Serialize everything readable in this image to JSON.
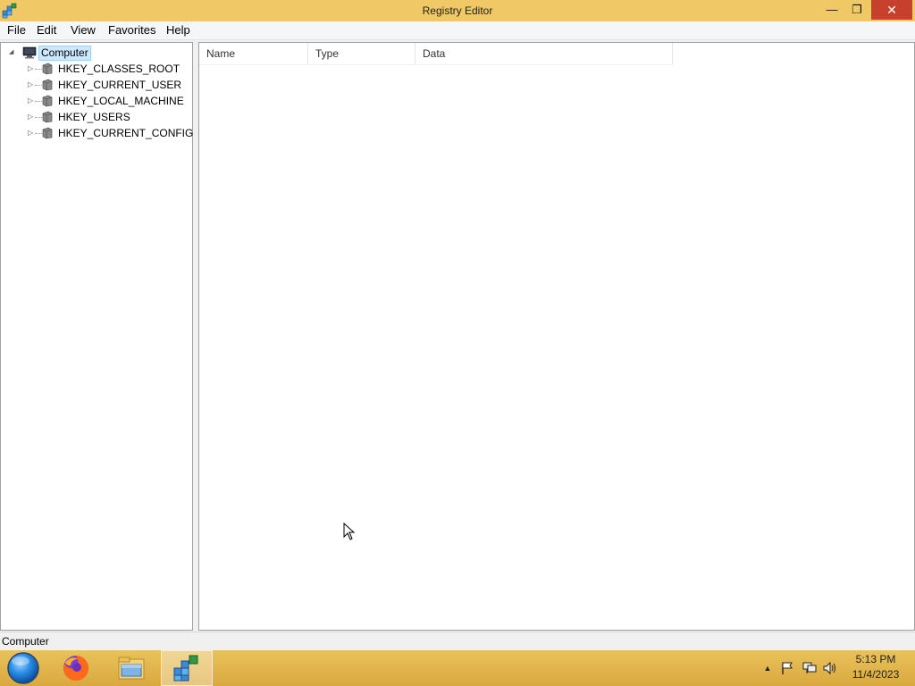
{
  "window": {
    "title": "Registry Editor",
    "minimize_glyph": "—",
    "maximize_glyph": "❐",
    "close_glyph": "✕"
  },
  "menu": {
    "items": [
      "File",
      "Edit",
      "View",
      "Favorites",
      "Help"
    ]
  },
  "tree": {
    "root": {
      "label": "Computer",
      "expander": "◢",
      "icon": "computer-icon",
      "selected": true
    },
    "keys": [
      {
        "label": "HKEY_CLASSES_ROOT",
        "expander": "▷",
        "icon": "registry-hive-icon"
      },
      {
        "label": "HKEY_CURRENT_USER",
        "expander": "▷",
        "icon": "registry-hive-icon"
      },
      {
        "label": "HKEY_LOCAL_MACHINE",
        "expander": "▷",
        "icon": "registry-hive-icon"
      },
      {
        "label": "HKEY_USERS",
        "expander": "▷",
        "icon": "registry-hive-icon"
      },
      {
        "label": "HKEY_CURRENT_CONFIG",
        "expander": "▷",
        "icon": "registry-hive-icon"
      }
    ]
  },
  "list": {
    "columns": [
      "Name",
      "Type",
      "Data"
    ]
  },
  "statusbar": {
    "text": "Computer"
  },
  "taskbar": {
    "items": [
      {
        "name": "start-button",
        "icon": "start-orb-icon"
      },
      {
        "name": "firefox-taskbar-button",
        "icon": "firefox-icon"
      },
      {
        "name": "file-explorer-taskbar-button",
        "icon": "folder-icon"
      },
      {
        "name": "registry-editor-taskbar-button",
        "icon": "regedit-icon",
        "active": true
      }
    ],
    "tray": {
      "show_hidden_glyph": "▲",
      "icons": [
        "action-center-flag-icon",
        "network-icon",
        "volume-icon"
      ]
    },
    "clock": {
      "time": "5:13 PM",
      "date": "11/4/2023"
    }
  },
  "colors": {
    "titlebar": "#f0c865",
    "taskbar": "#e1b64c",
    "close_button": "#c7402c",
    "selection": "#cce8ff"
  }
}
